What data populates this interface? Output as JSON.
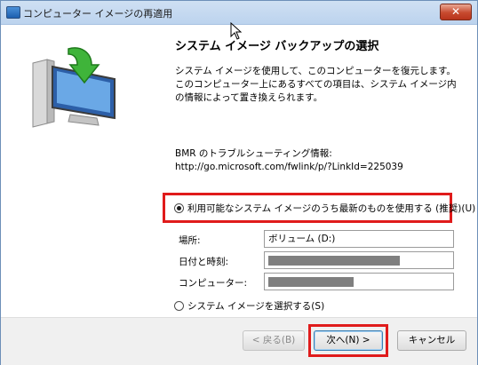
{
  "window": {
    "title": "コンピューター イメージの再適用",
    "close_label": "✕"
  },
  "main": {
    "heading": "システム イメージ バックアップの選択",
    "description": "システム イメージを使用して、このコンピューターを復元します。このコンピューター上にあるすべての項目は、システム イメージ内の情報によって置き換えられます。",
    "bmr_label": "BMR のトラブルシューティング情報:",
    "bmr_url": "http://go.microsoft.com/fwlink/p/?LinkId=225039"
  },
  "options": {
    "latest": {
      "label": "利用可能なシステム イメージのうち最新のものを使用する (推奨)(U)",
      "checked": true
    },
    "select": {
      "label": "システム イメージを選択する(S)",
      "checked": false
    }
  },
  "fields": {
    "location": {
      "label": "場所:",
      "value": "ボリューム (D:)"
    },
    "datetime": {
      "label": "日付と時刻:",
      "value": ""
    },
    "computer": {
      "label": "コンピューター:",
      "value": ""
    }
  },
  "buttons": {
    "back": "< 戻る(B)",
    "next": "次へ(N) >",
    "cancel": "キャンセル"
  },
  "colors": {
    "highlight": "#e01b1b",
    "titlebar": "#c4d8f0"
  }
}
